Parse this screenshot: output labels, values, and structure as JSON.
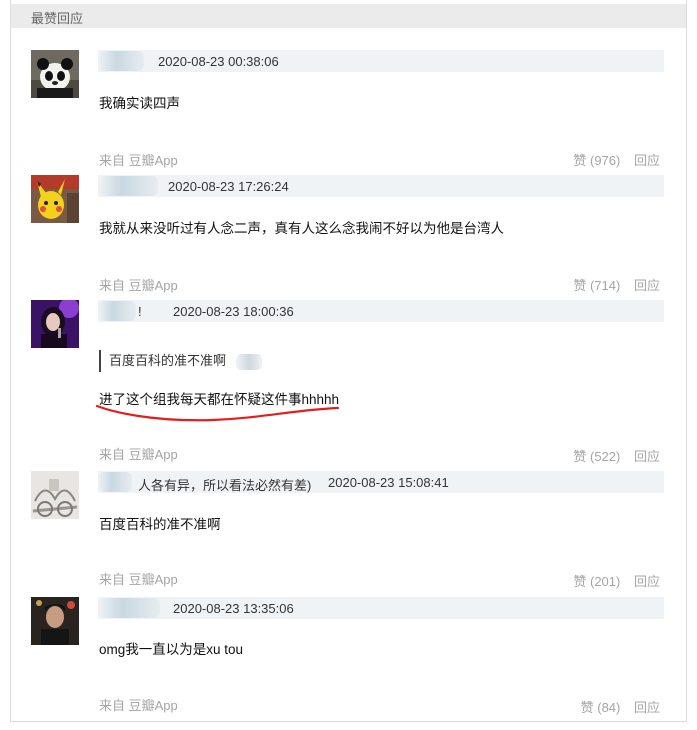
{
  "section_title": "最赞回应",
  "comments": [
    {
      "avatar": "panda-avatar",
      "timestamp": "2020-08-23 00:38:06",
      "user_note": "",
      "quote": "",
      "text": "我确实读四声",
      "source": "来自 豆瓣App",
      "likes": "赞 (976)",
      "reply": "回应"
    },
    {
      "avatar": "pikachu-avatar",
      "timestamp": "2020-08-23 17:26:24",
      "user_note": "",
      "quote": "",
      "text": "我就从来没听过有人念二声，真有人这么念我闹不好以为他是台湾人",
      "source": "来自 豆瓣App",
      "likes": "赞 (714)",
      "reply": "回应"
    },
    {
      "avatar": "singer-avatar",
      "timestamp": "2020-08-23 18:00:36",
      "user_note": "!",
      "quote": "百度百科的准不准啊",
      "text": "进了这个组我每天都在怀疑这件事hhhhh",
      "source": "来自 豆瓣App",
      "likes": "赞 (522)",
      "reply": "回应"
    },
    {
      "avatar": "sketch-avatar",
      "timestamp": "2020-08-23 15:08:41",
      "user_note": "人各有异，所以看法必然有差)",
      "quote": "",
      "text": "百度百科的准不准啊",
      "source": "来自 豆瓣App",
      "likes": "赞 (201)",
      "reply": "回应"
    },
    {
      "avatar": "person-avatar",
      "timestamp": "2020-08-23 13:35:06",
      "user_note": "",
      "quote": "",
      "text": "omg我一直以为是xu tou",
      "source": "来自 豆瓣App",
      "likes": "赞 (84)",
      "reply": "回应"
    }
  ],
  "colors": {
    "header_bg": "#ebebeb",
    "meta_bar": "#f0f3f5",
    "muted": "#a5a5a5",
    "annotation": "#e02020"
  }
}
